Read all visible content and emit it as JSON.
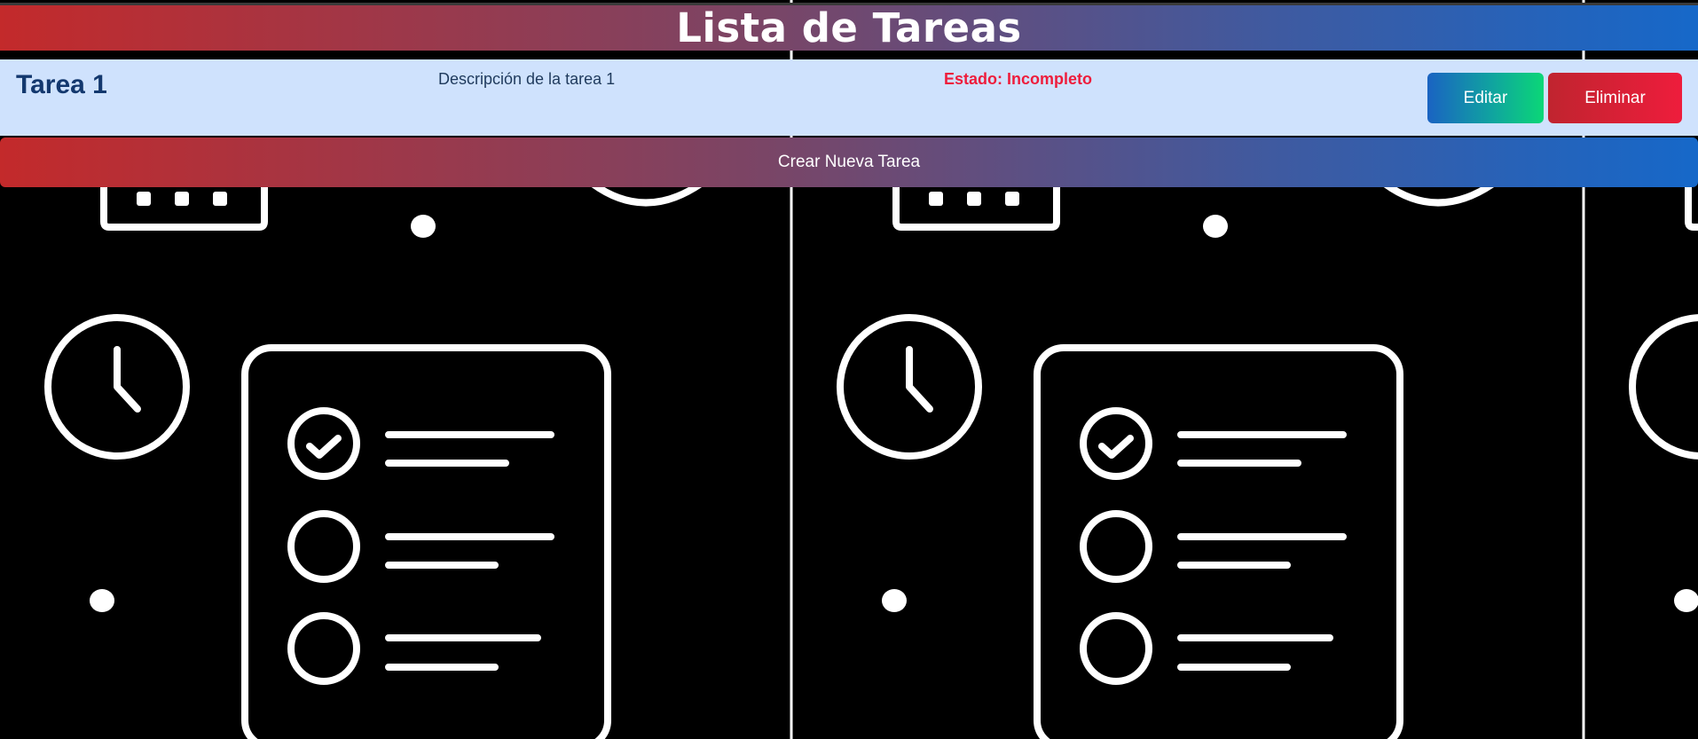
{
  "header": {
    "title": "Lista de Tareas"
  },
  "tasks": [
    {
      "title": "Tarea 1",
      "description": "Descripción de la tarea 1",
      "status": "Estado: Incompleto",
      "edit_label": "Editar",
      "delete_label": "Eliminar"
    }
  ],
  "actions": {
    "create_label": "Crear Nueva Tarea"
  },
  "background": {
    "icons": [
      "clock-icon",
      "checklist-icon",
      "calendar-icon"
    ],
    "color": "#000000",
    "stroke": "#ffffff"
  },
  "colors": {
    "gradient": [
      "#c32a2b",
      "#7a4566",
      "#3f5aa0",
      "#1668c9"
    ],
    "task_bg": "#cfe2fd",
    "status": "#ee1d3c",
    "title": "#13386e"
  }
}
